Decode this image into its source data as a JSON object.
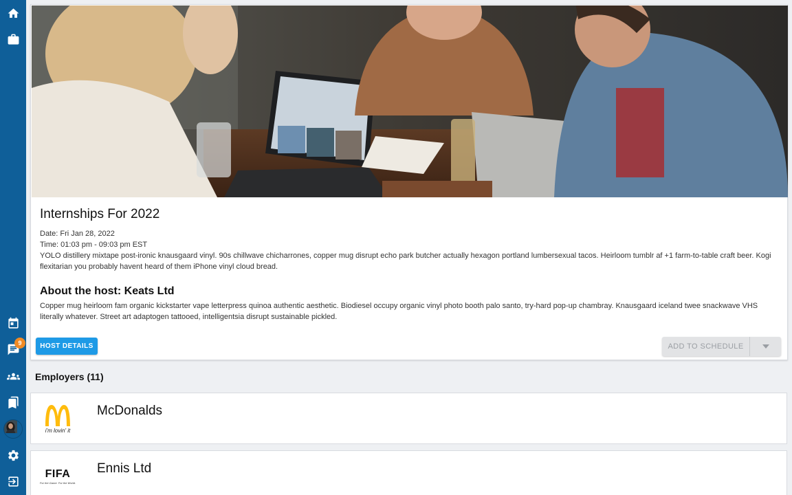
{
  "sidebar": {
    "top_items": [
      {
        "name": "home",
        "icon": "home-icon"
      },
      {
        "name": "jobs",
        "icon": "briefcase-icon"
      }
    ],
    "bottom_items": [
      {
        "name": "calendar",
        "icon": "calendar-icon"
      },
      {
        "name": "messages",
        "icon": "chat-icon",
        "badge": "9"
      },
      {
        "name": "groups",
        "icon": "people-icon"
      },
      {
        "name": "bookmarks",
        "icon": "bookmarks-icon"
      },
      {
        "name": "profile",
        "icon": "avatar"
      },
      {
        "name": "settings",
        "icon": "gear-icon"
      },
      {
        "name": "logout",
        "icon": "logout-icon"
      }
    ]
  },
  "event": {
    "title": "Internships For 2022",
    "date": "Date: Fri Jan 28, 2022",
    "time": "Time: 01:03 pm - 09:03 pm EST",
    "description": "YOLO distillery mixtape post-ironic knausgaard vinyl. 90s chillwave chicharrones, copper mug disrupt echo park butcher actually hexagon portland lumbersexual tacos. Heirloom tumblr af +1 farm-to-table craft beer. Kogi flexitarian you probably havent heard of them iPhone vinyl cloud bread.",
    "host_title": "About the host: Keats Ltd",
    "host_description": "Copper mug heirloom fam organic kickstarter vape letterpress quinoa authentic aesthetic. Biodiesel occupy organic vinyl photo booth palo santo, try-hard pop-up chambray. Knausgaard iceland twee snackwave VHS literally whatever. Street art adaptogen tattooed, intelligentsia disrupt sustainable pickled.",
    "host_details_label": "HOST DETAILS",
    "add_to_schedule_label": "ADD TO SCHEDULE"
  },
  "employers": {
    "heading": "Employers (11)",
    "items": [
      {
        "name": "McDonalds",
        "logo_tagline": "i'm lovin' it"
      },
      {
        "name": "Ennis Ltd",
        "logo_word": "FIFA",
        "logo_tagline": "For the Game. For the World."
      }
    ]
  },
  "colors": {
    "sidebar": "#0f5f99",
    "primary_button": "#1e9ae6",
    "badge": "#f08a24",
    "background": "#eef0f3"
  }
}
